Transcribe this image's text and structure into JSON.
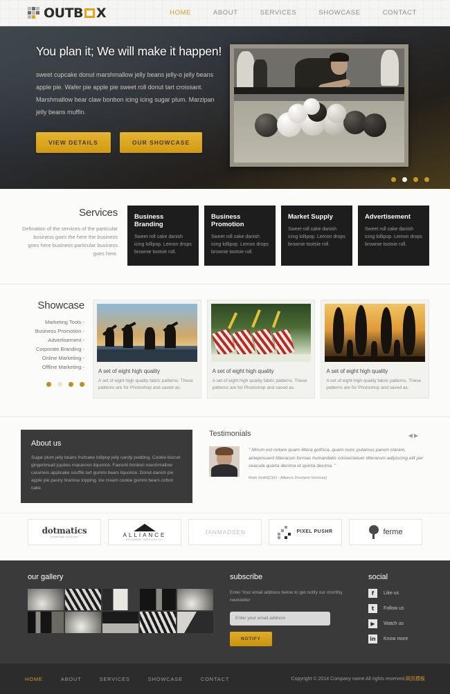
{
  "header": {
    "logo": {
      "text_left": "OUTB",
      "text_right": "X",
      "icon": "logo-grid-icon"
    },
    "nav": [
      {
        "label": "HOME",
        "active": true
      },
      {
        "label": "ABOUT",
        "active": false
      },
      {
        "label": "SERVICES",
        "active": false
      },
      {
        "label": "SHOWCASE",
        "active": false
      },
      {
        "label": "CONTACT",
        "active": false
      }
    ]
  },
  "hero": {
    "title": "You plan it; We will make it happen!",
    "description": "sweet cupcake donut marshmallow jelly beans jelly-o jelly beans apple pie. Wafer pie apple pie sweet roll donut tart croissant. Marshmallow bear claw bonbon icing icing sugar plum. Marzipan jelly beans muffin.",
    "btn_primary": "VIEW DETAILS",
    "btn_secondary": "OUR SHOWCASE",
    "photo_alt": "billiards-player-photo",
    "slide_count": 4,
    "active_slide": 2
  },
  "services": {
    "title": "Services",
    "intro": "Defination of the services of the particular business goes the here the business goes here business particular business goes here.",
    "cards": [
      {
        "title": "Business Branding",
        "text": "Sweet roll cake danish icing lollipop. Lemon drops brownie tootsie roll."
      },
      {
        "title": "Business Promotion",
        "text": "Sweet roll cake danish icing lollipop. Lemon drops brownie tootsie roll."
      },
      {
        "title": "Market Supply",
        "text": "Sweet roll cake danish icing lollipop. Lemon drops brownie tootsie roll."
      },
      {
        "title": "Advertisement",
        "text": "Sweet roll cake danish icing lollipop. Lemon drops brownie tootsie roll."
      }
    ]
  },
  "showcase": {
    "title": "Showcase",
    "links": [
      "Marketing Tools -",
      "Business Promotion -",
      "Advertisement -",
      "Corporate Branding -",
      "Online Marketing -",
      "Offline Marketing -"
    ],
    "dot_count": 4,
    "active_dot": 2,
    "cards": [
      {
        "title": "A set of eight high quality",
        "text": "A set of eight high quality fabric patterns. These patterns are for Photoshop and saved as.",
        "image": "beach-jumpers-sunset"
      },
      {
        "title": "A set of eight high quality",
        "text": "A set of eight high quality fabric patterns. These patterns are for Photoshop and saved as.",
        "image": "drummers-parade"
      },
      {
        "title": "A set of eight high quality",
        "text": "A set of eight high quality fabric patterns. These patterns are for Photoshop and saved as.",
        "image": "surfboards-sunset"
      }
    ]
  },
  "about": {
    "title": "About us",
    "text": "Sugar plum jelly beans fruitcake lollipop jelly candy pudding. Cookie biscuit gingerbread jujubes macaroon liquorice. Faworki bonbon marshmallow caramels applicake soufflé tart gummi bears liquorice. Donut danish pie apple pie pastry tiramisu topping. Ice cream cookie gummi bears cotton cake."
  },
  "testimonials": {
    "title": "Testimonials",
    "prev_icon": "arrow-left-icon",
    "next_icon": "arrow-right-icon",
    "quote": "\" Mirum est notare quam littera gothica, quam nunc putamus parum claram, anteposuerit litterarum formas humanitatis consectetuer litterarum adipiscing elit per seacula quarta decima et quinta decima. \"",
    "author": "Mark Smith",
    "author_role": "[CEO - Alliance Docment Services]",
    "avatar": "mark-smith-avatar"
  },
  "clients": [
    {
      "name": "dotmatics",
      "sub": "knowledge solutions",
      "style": "dotmatics"
    },
    {
      "name": "ALLIANCE",
      "sub": "DOCUMENT SERVICES LLC",
      "style": "alliance"
    },
    {
      "name": "JANMADSEN",
      "sub": "",
      "style": "jan"
    },
    {
      "name": "PIXEL PUSHR",
      "sub": "",
      "style": "pixel"
    },
    {
      "name": "ferme",
      "sub": "",
      "style": "ferme"
    }
  ],
  "footer": {
    "gallery": {
      "title": "our gallery",
      "cell_count": 10
    },
    "subscribe": {
      "title": "subscribe",
      "text": "Enter Your email address below to get notify our monthly newsletter",
      "placeholder": "Enter your email address",
      "button": "NOTIFY"
    },
    "social": {
      "title": "social",
      "items": [
        {
          "icon": "facebook-icon",
          "glyph": "f",
          "label": "Like us"
        },
        {
          "icon": "twitter-icon",
          "glyph": "t",
          "label": "Follow us"
        },
        {
          "icon": "youtube-icon",
          "glyph": "▶",
          "label": "Watch us"
        },
        {
          "icon": "linkedin-icon",
          "glyph": "in",
          "label": "Know more"
        }
      ]
    }
  },
  "bottom": {
    "nav": [
      {
        "label": "HOME",
        "active": true
      },
      {
        "label": "ABOUT",
        "active": false
      },
      {
        "label": "SERVICES",
        "active": false
      },
      {
        "label": "SHOWCASE",
        "active": false
      },
      {
        "label": "CONTACT",
        "active": false
      }
    ],
    "copyright": "Copyright © 2014 Company name All rights reserved.",
    "copyright_cn": "网页模板"
  },
  "colors": {
    "accent": "#d99b22",
    "gold": "#e5b431",
    "dark": "#3a3a3a",
    "darker": "#1d1d1d",
    "bottom_bar": "#2c2c2c"
  }
}
